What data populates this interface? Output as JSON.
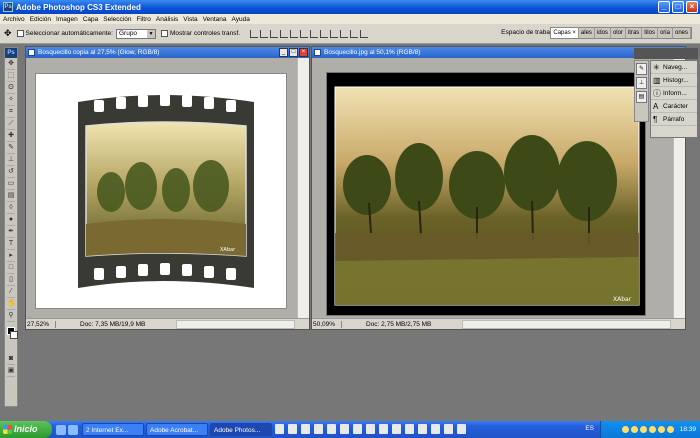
{
  "window": {
    "title": "Adobe Photoshop CS3 Extended"
  },
  "menu": [
    "Archivo",
    "Edición",
    "Imagen",
    "Capa",
    "Selección",
    "Filtro",
    "Análisis",
    "Vista",
    "Ventana",
    "Ayuda"
  ],
  "options": {
    "auto_select_label": "Seleccionar automáticamente:",
    "auto_select_value": "Grupo",
    "transform_label": "Mostrar controles transf.",
    "workspace_label": "Espacio de trabajo",
    "panel_tabs": [
      "Capas ×",
      "ales",
      "idos",
      "olor",
      "itras",
      "tilos",
      "oria",
      "ones"
    ]
  },
  "documents": [
    {
      "title": "Bosquecillo copia al 27,5% (Glow, RGB/8)",
      "zoom": "27,52%",
      "doc": "Doc: 7,35 MB/19,9 MB",
      "watermark": "XAbar"
    },
    {
      "title": "Bosquecillo.jpg al 50,1% (RGB/8)",
      "zoom": "50,09%",
      "doc": "Doc: 2,75 MB/2,75 MB",
      "watermark": "XAbar"
    }
  ],
  "panel": {
    "items": [
      {
        "label": "Naveg...",
        "icon": "navigator-icon"
      },
      {
        "label": "Histogr...",
        "icon": "histogram-icon"
      },
      {
        "label": "Inform...",
        "icon": "info-icon"
      },
      {
        "label": "Carácter",
        "icon": "character-icon"
      },
      {
        "label": "Párrafo",
        "icon": "paragraph-icon"
      }
    ]
  },
  "taskbar": {
    "start": "Inicio",
    "tasks": [
      "2 Internet Ex...",
      "Adobe Acrobat...",
      "Adobe Photos..."
    ],
    "lang": "ES",
    "clock": "18:39"
  },
  "colors": {
    "titlebar": "#0b4fd6",
    "taskbar": "#245edb",
    "workspace": "#777777"
  }
}
